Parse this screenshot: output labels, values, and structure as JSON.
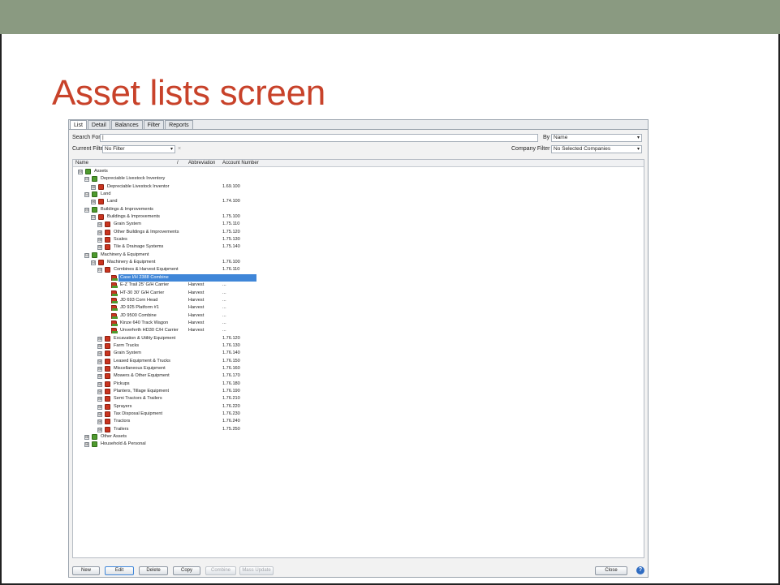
{
  "slide": {
    "title": "Asset lists screen"
  },
  "tabs": [
    "List",
    "Detail",
    "Balances",
    "Filter",
    "Reports"
  ],
  "search": {
    "label": "Search For",
    "value": "|",
    "by_label": "By",
    "by_value": "Name"
  },
  "filter": {
    "label": "Current Filter",
    "value": "No Filter",
    "clear": "×",
    "company_label": "Company Filter",
    "company_value": "No Selected Companies"
  },
  "grid": {
    "columns": {
      "name": "Name",
      "sort": "/",
      "abbreviation": "Abbreviation",
      "account": "Account Number"
    },
    "rows": [
      {
        "name": "Assets",
        "level": 0,
        "expander": "⊟",
        "icon": "green",
        "abbr": "",
        "acct": ""
      },
      {
        "name": "Depreciable Livestock Inventory",
        "level": 1,
        "expander": "⊟",
        "icon": "green",
        "abbr": "",
        "acct": ""
      },
      {
        "name": "Depreciable Livestock Inventor",
        "level": 2,
        "expander": "⊞",
        "icon": "red",
        "abbr": "",
        "acct": "1.69.100"
      },
      {
        "name": "Land",
        "level": 1,
        "expander": "⊟",
        "icon": "green",
        "abbr": "",
        "acct": ""
      },
      {
        "name": "Land",
        "level": 2,
        "expander": "⊞",
        "icon": "red",
        "abbr": "",
        "acct": "1.74.100"
      },
      {
        "name": "Buildings & Improvements",
        "level": 1,
        "expander": "⊟",
        "icon": "green",
        "abbr": "",
        "acct": ""
      },
      {
        "name": "Buildings & Improvements",
        "level": 2,
        "expander": "⊟",
        "icon": "red",
        "abbr": "",
        "acct": "1.75.100"
      },
      {
        "name": "Grain System",
        "level": 3,
        "expander": "⊞",
        "icon": "red",
        "abbr": "",
        "acct": "1.75.110"
      },
      {
        "name": "Other Buildings & Improvements",
        "level": 3,
        "expander": "⊞",
        "icon": "red",
        "abbr": "",
        "acct": "1.75.120"
      },
      {
        "name": "Scales",
        "level": 3,
        "expander": "⊞",
        "icon": "red",
        "abbr": "",
        "acct": "1.75.130"
      },
      {
        "name": "Tile & Drainage Systems",
        "level": 3,
        "expander": "⊞",
        "icon": "red",
        "abbr": "",
        "acct": "1.75.140"
      },
      {
        "name": "Machinery & Equipment",
        "level": 1,
        "expander": "⊟",
        "icon": "green",
        "abbr": "",
        "acct": ""
      },
      {
        "name": "Machinery & Equipment",
        "level": 2,
        "expander": "⊟",
        "icon": "red",
        "abbr": "",
        "acct": "1.76.100"
      },
      {
        "name": "Combines & Harvest Equipment",
        "level": 3,
        "expander": "⊟",
        "icon": "red",
        "abbr": "",
        "acct": "1.76.110"
      },
      {
        "name": "Case I/H 2388 Combine",
        "level": 4,
        "expander": "",
        "icon": "tractor",
        "abbr": "",
        "acct": "",
        "selected": true
      },
      {
        "name": "E-Z Trail 25' G/H Carrier",
        "level": 4,
        "expander": "",
        "icon": "tractor",
        "abbr": "Harvest",
        "acct": "..."
      },
      {
        "name": "HT-30 30' G/H Carrier",
        "level": 4,
        "expander": "",
        "icon": "tractor",
        "abbr": "Harvest",
        "acct": "..."
      },
      {
        "name": "JD 693 Corn Head",
        "level": 4,
        "expander": "",
        "icon": "tractor",
        "abbr": "Harvest",
        "acct": "..."
      },
      {
        "name": "JD 925 Platform #1",
        "level": 4,
        "expander": "",
        "icon": "tractor",
        "abbr": "Harvest",
        "acct": "..."
      },
      {
        "name": "JD 9500 Combine",
        "level": 4,
        "expander": "",
        "icon": "tractor",
        "abbr": "Harvest",
        "acct": "..."
      },
      {
        "name": "Kinze 640 Track Wagon",
        "level": 4,
        "expander": "",
        "icon": "tractor",
        "abbr": "Harvest",
        "acct": "..."
      },
      {
        "name": "Unverferth HD30 C/H Carrier",
        "level": 4,
        "expander": "",
        "icon": "tractor",
        "abbr": "Harvest",
        "acct": "..."
      },
      {
        "name": "Excavation & Utility Equipment",
        "level": 3,
        "expander": "⊞",
        "icon": "red",
        "abbr": "",
        "acct": "1.76.120"
      },
      {
        "name": "Farm Trucks",
        "level": 3,
        "expander": "⊞",
        "icon": "red",
        "abbr": "",
        "acct": "1.76.130"
      },
      {
        "name": "Grain System",
        "level": 3,
        "expander": "⊞",
        "icon": "red",
        "abbr": "",
        "acct": "1.76.140"
      },
      {
        "name": "Leased Equipment & Trucks",
        "level": 3,
        "expander": "⊞",
        "icon": "red",
        "abbr": "",
        "acct": "1.76.150"
      },
      {
        "name": "Miscellaneous Equipment",
        "level": 3,
        "expander": "⊞",
        "icon": "red",
        "abbr": "",
        "acct": "1.76.160"
      },
      {
        "name": "Mowers & Other Equipment",
        "level": 3,
        "expander": "⊞",
        "icon": "red",
        "abbr": "",
        "acct": "1.76.170"
      },
      {
        "name": "Pickups",
        "level": 3,
        "expander": "⊞",
        "icon": "red",
        "abbr": "",
        "acct": "1.76.180"
      },
      {
        "name": "Planters, Tillage Equipment",
        "level": 3,
        "expander": "⊞",
        "icon": "red",
        "abbr": "",
        "acct": "1.76.190"
      },
      {
        "name": "Semi Tractors & Trailers",
        "level": 3,
        "expander": "⊞",
        "icon": "red",
        "abbr": "",
        "acct": "1.76.210"
      },
      {
        "name": "Sprayers",
        "level": 3,
        "expander": "⊞",
        "icon": "red",
        "abbr": "",
        "acct": "1.76.220"
      },
      {
        "name": "Tax Disposal Equipment",
        "level": 3,
        "expander": "⊞",
        "icon": "red",
        "abbr": "",
        "acct": "1.76.230"
      },
      {
        "name": "Tractors",
        "level": 3,
        "expander": "⊞",
        "icon": "red",
        "abbr": "",
        "acct": "1.76.240"
      },
      {
        "name": "Trailers",
        "level": 3,
        "expander": "⊞",
        "icon": "red",
        "abbr": "",
        "acct": "1.75.250"
      },
      {
        "name": "Other Assets",
        "level": 1,
        "expander": "⊞",
        "icon": "green",
        "abbr": "",
        "acct": ""
      },
      {
        "name": "Household & Personal",
        "level": 1,
        "expander": "⊞",
        "icon": "green",
        "abbr": "",
        "acct": ""
      }
    ]
  },
  "buttons": {
    "new": "New",
    "edit": "Edit",
    "delete": "Delete",
    "copy": "Copy",
    "combine": "Combine",
    "mass_update": "Mass Update",
    "close": "Close",
    "help": "?"
  },
  "colors": {
    "topbar": "#8a9a81",
    "title": "#c8422a",
    "selection": "#3f86d8"
  }
}
